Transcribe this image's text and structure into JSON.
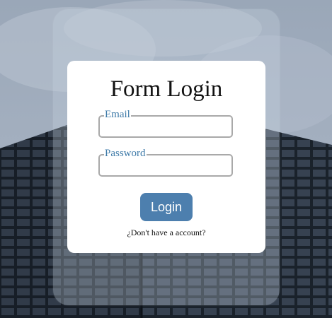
{
  "form": {
    "title": "Form Login",
    "email": {
      "label": "Email",
      "value": ""
    },
    "password": {
      "label": "Password",
      "value": ""
    },
    "login_button": "Login",
    "signup_prompt": "¿Don't have a account?"
  },
  "colors": {
    "accent": "#4d7fae",
    "label": "#3e7aa8",
    "card": "#ffffff",
    "input_border": "#a9a9a9"
  }
}
